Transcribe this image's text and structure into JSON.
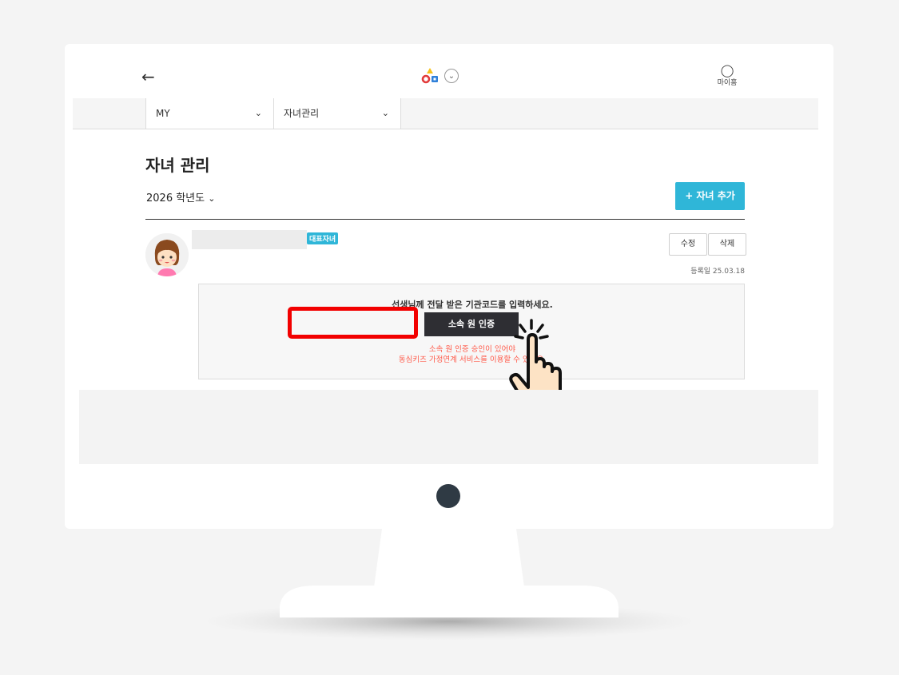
{
  "header": {
    "back_icon": "arrow-left-icon",
    "logo_icon": "brand-logo-icon",
    "menu_chevron_icon": "chevron-down-icon",
    "my_label": "마이홈",
    "my_icon": "person-icon"
  },
  "breadcrumb": {
    "items": [
      {
        "label": "MY"
      },
      {
        "label": "자녀관리"
      }
    ]
  },
  "page": {
    "title": "자녀 관리",
    "year_select": "2026 학년도",
    "add_child_label": "+ 자녀 추가"
  },
  "child": {
    "representative_badge": "대표자녀",
    "edit_label": "수정",
    "delete_label": "삭제",
    "registered": "등록일 25.03.18"
  },
  "verification": {
    "prompt": "선생님께 전달 받은 기관코드를 입력하세요.",
    "button_label": "소속 원 인증",
    "notice_line1": "소속 원 인증 승인이 있어야",
    "notice_line2": "동심키즈 가정연계 서비스를 이용할 수 있어요."
  },
  "colors": {
    "accent": "#2fb6d8",
    "dark_button": "#2e2e33",
    "highlight": "#f20000",
    "notice": "#ff5a4a"
  }
}
